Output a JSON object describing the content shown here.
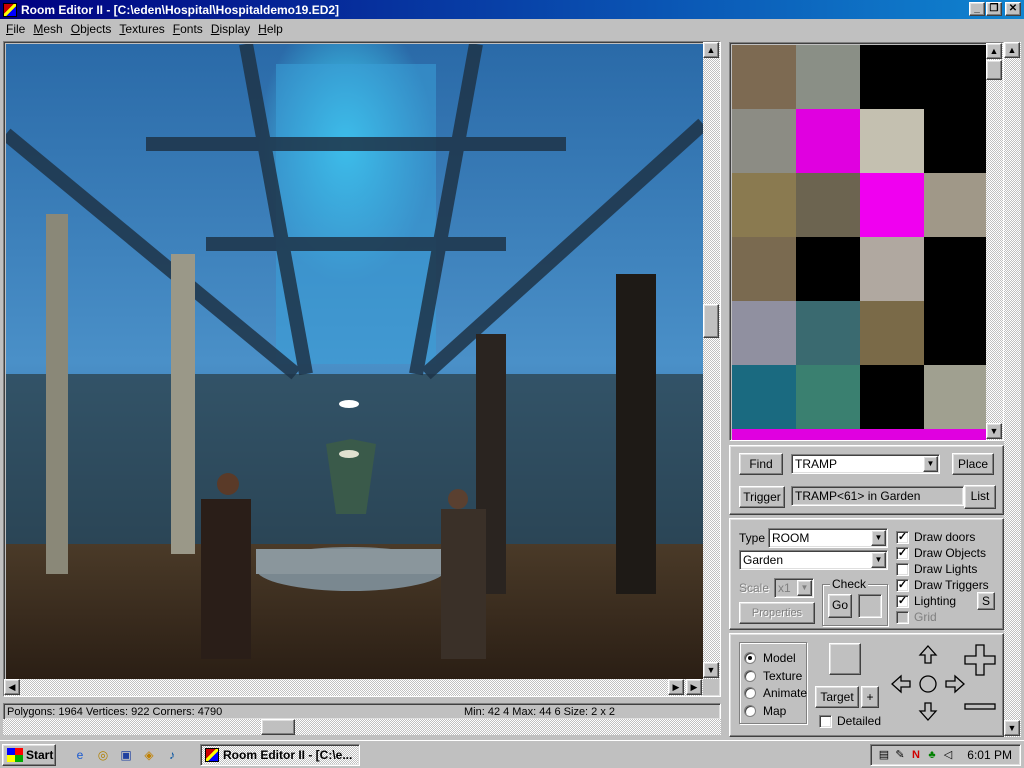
{
  "window": {
    "title": "Room Editor II - [C:\\eden\\Hospital\\Hospitaldemo19.ED2]",
    "minimize_glyph": "_",
    "restore_glyph": "❐",
    "close_glyph": "✕"
  },
  "menu": [
    "File",
    "Mesh",
    "Objects",
    "Textures",
    "Fonts",
    "Display",
    "Help"
  ],
  "status": {
    "left": "Polygons: 1964  Vertices: 922  Corners: 4790",
    "right": "Min: 42 4   Max: 44 6   Size: 2 x 2"
  },
  "texture_swatches": [
    "#7d6a52",
    "#8a8f86",
    "#000000",
    "#000000",
    "#8c8c84",
    "#e000e0",
    "#c4c0b0",
    "#000000",
    "#8a7a50",
    "#6c6450",
    "#f000f0",
    "#a09888",
    "#7a6a50",
    "#000000",
    "#b0a8a0",
    "#000000",
    "#9090a0",
    "#3a6a70",
    "#7a6a48",
    "#000000",
    "#1a6a80",
    "#3a8070",
    "#000000",
    "#a0a090",
    "#e000e0",
    "#e000e0",
    "#e000e0",
    "#e000e0"
  ],
  "search": {
    "find_label": "Find",
    "find_value": "TRAMP",
    "place_label": "Place",
    "trigger_label": "Trigger",
    "trigger_value": "TRAMP<61> in Garden",
    "list_label": "List"
  },
  "properties": {
    "type_label": "Type",
    "type_value": "ROOM",
    "room_value": "Garden",
    "scale_label": "Scale",
    "scale_value": "x1",
    "properties_label": "Properties",
    "check_label": "Check",
    "go_label": "Go",
    "s_label": "S",
    "checkboxes": [
      {
        "label": "Draw doors",
        "checked": true
      },
      {
        "label": "Draw Objects",
        "checked": true
      },
      {
        "label": "Draw Lights",
        "checked": false
      },
      {
        "label": "Draw Triggers",
        "checked": true
      },
      {
        "label": "Lighting",
        "checked": true
      },
      {
        "label": "Grid",
        "checked": false
      }
    ]
  },
  "mode": {
    "radios": [
      {
        "label": "Model",
        "selected": true
      },
      {
        "label": "Texture",
        "selected": false
      },
      {
        "label": "Animate",
        "selected": false
      },
      {
        "label": "Map",
        "selected": false
      }
    ],
    "target_label": "Target",
    "plus_label": "+",
    "detailed_label": "Detailed"
  },
  "taskbar": {
    "start_label": "Start",
    "task_label": "Room Editor II - [C:\\e...",
    "clock": "6:01 PM"
  },
  "colors": {
    "titlebar_start": "#000080",
    "titlebar_end": "#1084d0",
    "window_face": "#c0c0c0"
  }
}
